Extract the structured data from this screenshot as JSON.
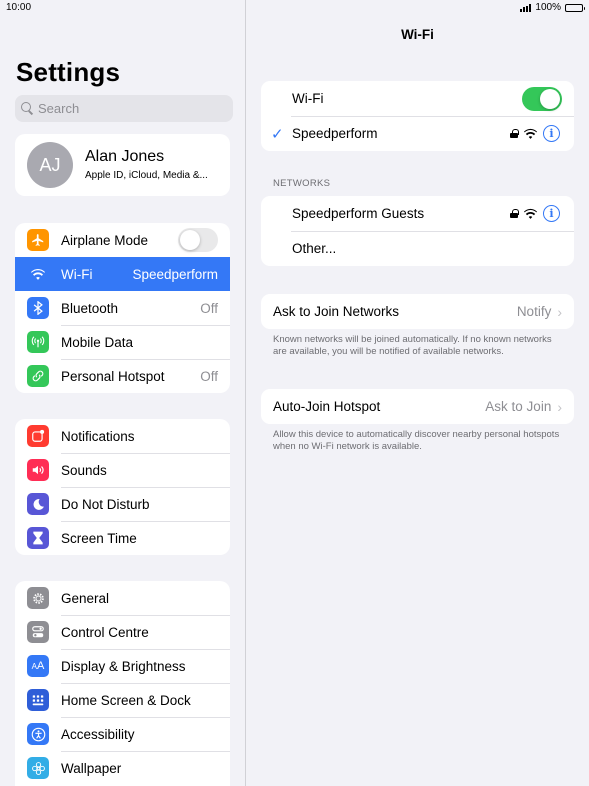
{
  "status_bar": {
    "time": "10:00",
    "battery": "100%"
  },
  "sidebar": {
    "title": "Settings",
    "search_placeholder": "Search",
    "profile": {
      "initials": "AJ",
      "name": "Alan Jones",
      "subtitle": "Apple ID, iCloud, Media &..."
    },
    "group1": [
      {
        "label": "Airplane Mode",
        "icon": "airplane-icon",
        "color": "#ff9500",
        "toggle": false
      },
      {
        "label": "Wi-Fi",
        "value": "Speedperform",
        "icon": "wifi-icon",
        "color": "#3478f6",
        "selected": true
      },
      {
        "label": "Bluetooth",
        "value": "Off",
        "icon": "bluetooth-icon",
        "color": "#3478f6"
      },
      {
        "label": "Mobile Data",
        "icon": "antenna-icon",
        "color": "#34c759"
      },
      {
        "label": "Personal Hotspot",
        "value": "Off",
        "icon": "hotspot-icon",
        "color": "#34c759"
      }
    ],
    "group2": [
      {
        "label": "Notifications",
        "icon": "notifications-icon",
        "color": "#ff3b30"
      },
      {
        "label": "Sounds",
        "icon": "speaker-icon",
        "color": "#ff2d55"
      },
      {
        "label": "Do Not Disturb",
        "icon": "moon-icon",
        "color": "#5856d6"
      },
      {
        "label": "Screen Time",
        "icon": "hourglass-icon",
        "color": "#5856d6"
      }
    ],
    "group3": [
      {
        "label": "General",
        "icon": "gear-icon",
        "color": "#8e8e93"
      },
      {
        "label": "Control Centre",
        "icon": "switches-icon",
        "color": "#8e8e93"
      },
      {
        "label": "Display & Brightness",
        "icon": "text-size-icon",
        "color": "#3478f6"
      },
      {
        "label": "Home Screen & Dock",
        "icon": "grid-icon",
        "color": "#3478f6"
      },
      {
        "label": "Accessibility",
        "icon": "accessibility-icon",
        "color": "#3478f6"
      },
      {
        "label": "Wallpaper",
        "icon": "flower-icon",
        "color": "#32ade6"
      }
    ]
  },
  "main": {
    "title": "Wi-Fi",
    "wifi_toggle_label": "Wi-Fi",
    "wifi_on": true,
    "connected_network": "Speedperform",
    "networks_header": "NETWORKS",
    "networks": [
      "Speedperform Guests",
      "Other..."
    ],
    "ask_to_join": {
      "label": "Ask to Join Networks",
      "value": "Notify",
      "note": "Known networks will be joined automatically. If no known networks are available, you will be notified of available networks."
    },
    "auto_join": {
      "label": "Auto-Join Hotspot",
      "value": "Ask to Join",
      "note": "Allow this device to automatically discover nearby personal hotspots when no Wi-Fi network is available."
    }
  }
}
